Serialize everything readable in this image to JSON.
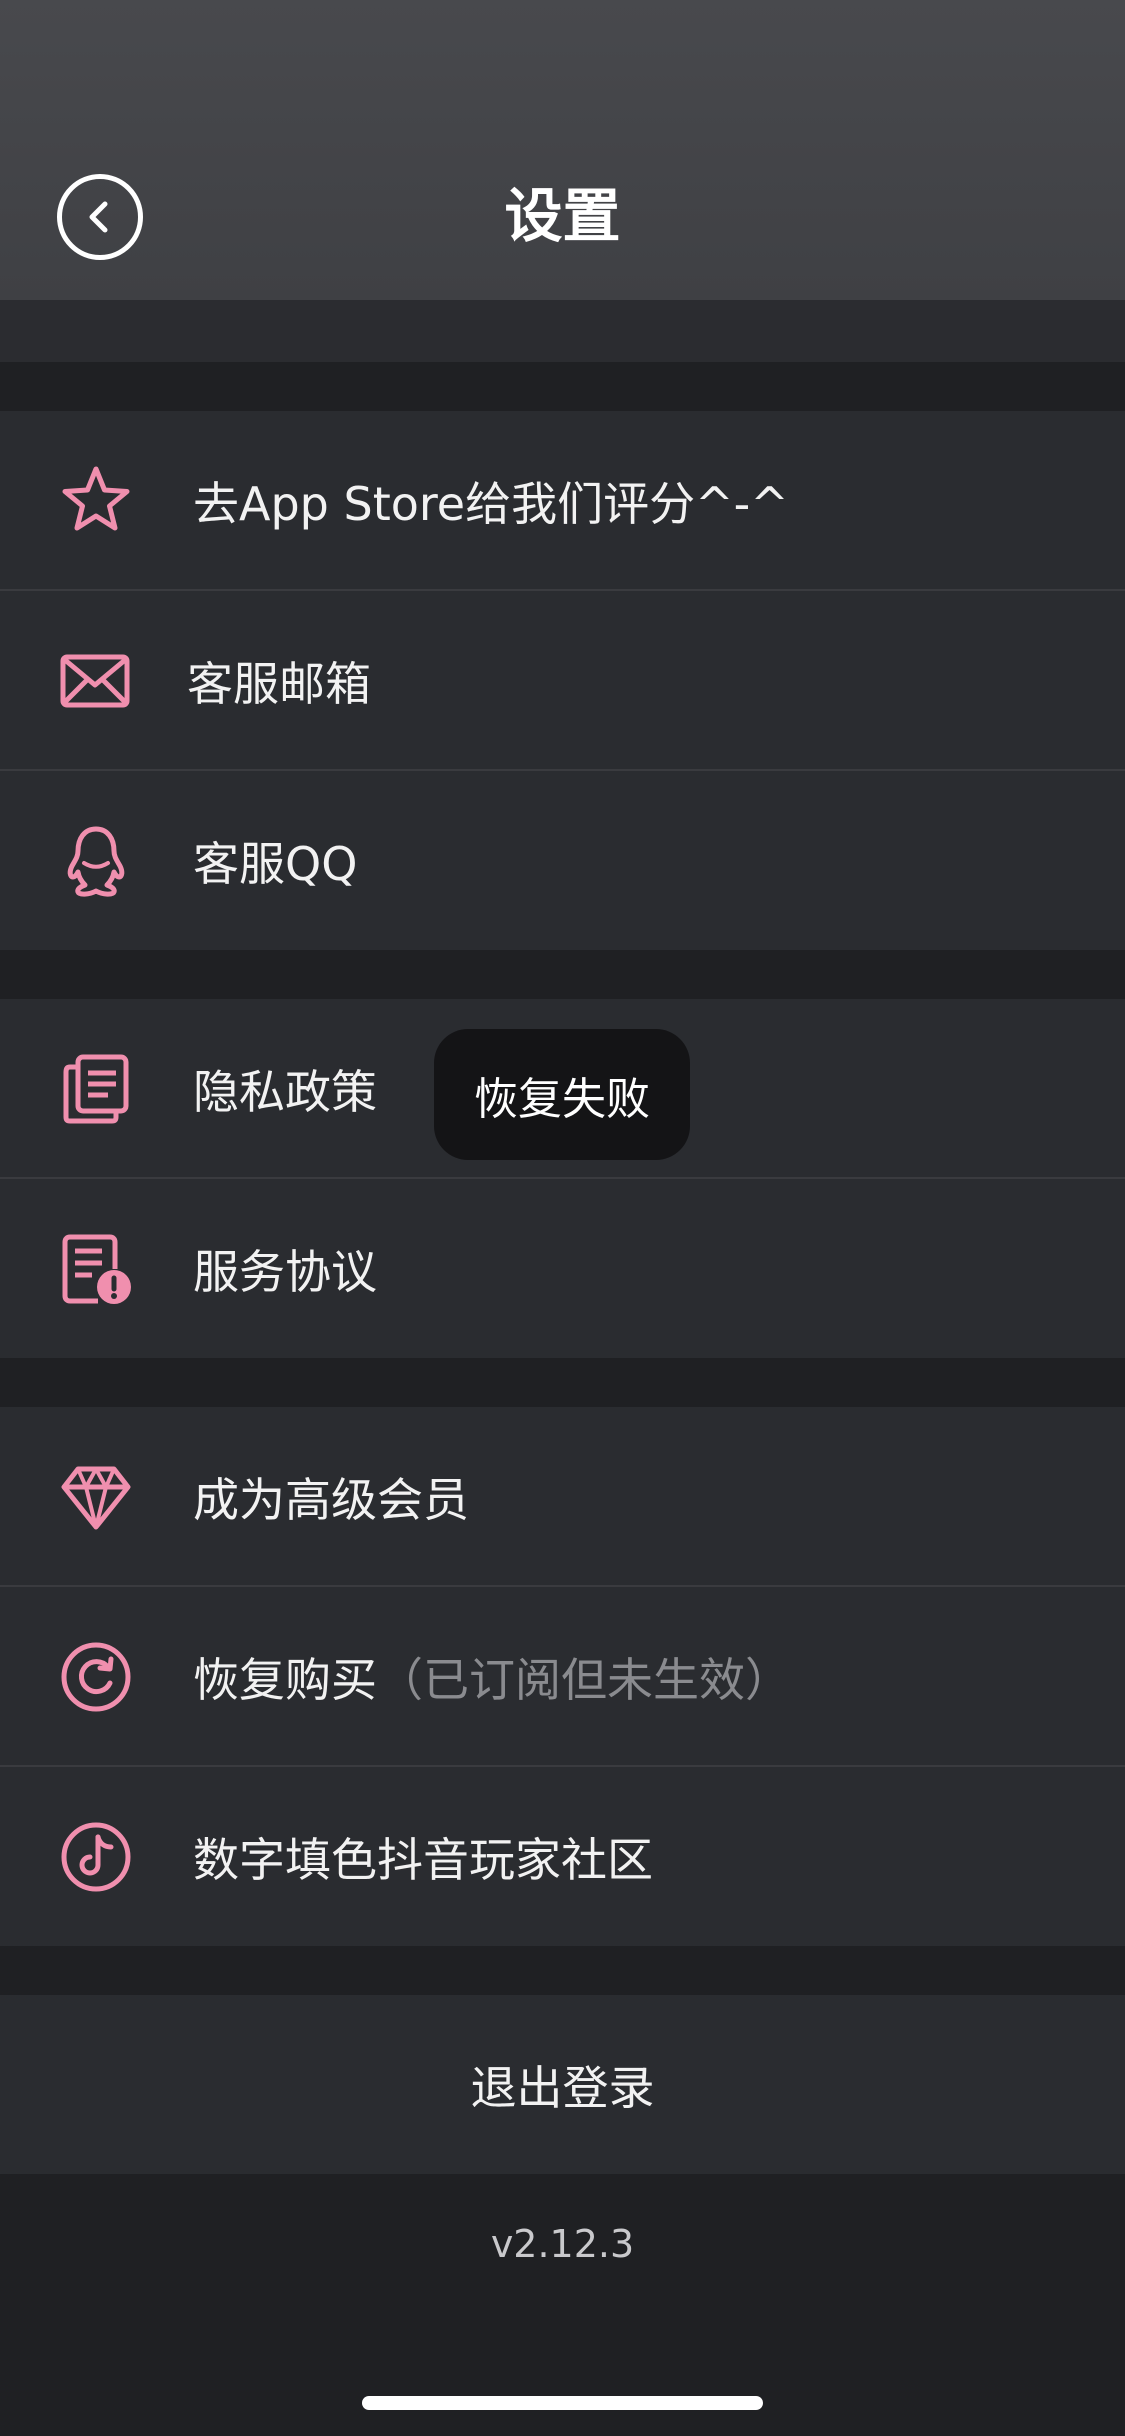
{
  "header": {
    "title": "设置"
  },
  "rows": [
    {
      "label": "去App Store给我们评分^-^",
      "icon": "star-icon"
    },
    {
      "label": "客服邮箱",
      "icon": "mail-icon"
    },
    {
      "label": "客服QQ",
      "icon": "qq-penguin-icon"
    },
    {
      "label": "隐私政策",
      "icon": "documents-icon"
    },
    {
      "label": "服务协议",
      "icon": "agreement-warning-icon"
    },
    {
      "label": "成为高级会员",
      "icon": "diamond-icon"
    },
    {
      "label": "恢复购买",
      "hint": "（已订阅但未生效）",
      "icon": "restore-icon"
    },
    {
      "label": "数字填色抖音玩家社区",
      "icon": "tiktok-icon"
    }
  ],
  "logout_label": "退出登录",
  "version": "v2.12.3",
  "toast": "恢复失败",
  "colors": {
    "accent": "#f08fae",
    "row_bg": "#2a2c30",
    "page_bg": "#1f2023",
    "header_bg": "#434448"
  }
}
